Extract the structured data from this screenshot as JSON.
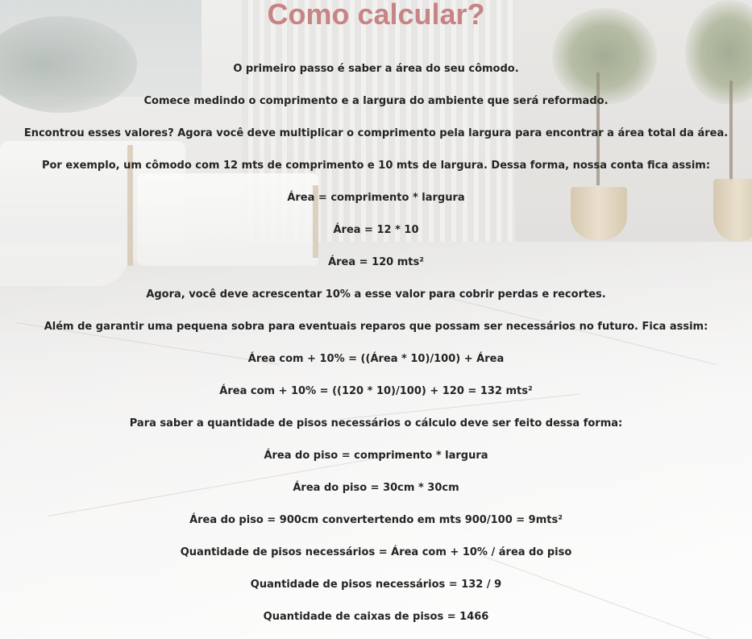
{
  "title": "Como calcular?",
  "lines": [
    "O primeiro passo é saber a área do seu cômodo.",
    "Comece medindo o comprimento e a largura do ambiente que será reformado.",
    "Encontrou esses valores? Agora você deve multiplicar o comprimento pela largura para encontrar a área total da área.",
    "Por exemplo, um cômodo com 12 mts de comprimento e 10 mts de largura. Dessa forma, nossa conta fica assim:",
    "Área = comprimento * largura",
    "Área = 12 * 10",
    "Área = 120 mts²",
    "Agora, você deve acrescentar 10% a esse valor para cobrir perdas e recortes.",
    "Além de garantir uma pequena sobra para eventuais reparos que possam ser necessários no futuro. Fica assim:",
    "Área com + 10% = ((Área * 10)/100) + Área",
    "Área com + 10% = ((120 * 10)/100) + 120 = 132 mts²",
    "Para saber a quantidade de pisos necessários o cálculo deve ser feito dessa forma:",
    "Área do piso = comprimento * largura",
    "Área do piso = 30cm * 30cm",
    "Área do piso = 900cm convertertendo em mts 900/100 = 9mts²",
    "Quantidade de pisos necessários = Área com + 10% / área do piso",
    "Quantidade de pisos necessários = 132 / 9",
    "Quantidade de caixas de pisos = 1466"
  ],
  "colors": {
    "title": "#c78484",
    "text": "#242424"
  }
}
